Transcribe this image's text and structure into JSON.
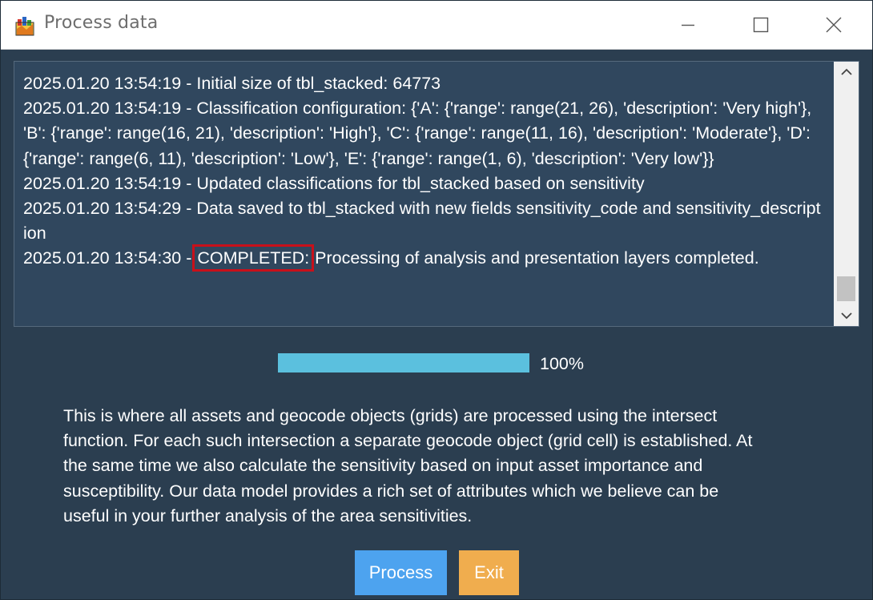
{
  "window": {
    "title": "Process data",
    "app_icon": "app-icon"
  },
  "log": {
    "lines": [
      "2025.01.20 13:54:19 - Initial size of tbl_stacked: 64773",
      "2025.01.20 13:54:19 - Classification configuration: {'A': {'range': range(21, 26), 'description': 'Very high'}, 'B': {'range': range(16, 21), 'description': 'High'}, 'C': {'range': range(11, 16), 'description': 'Moderate'}, 'D': {'range': range(6, 11), 'description': 'Low'}, 'E': {'range': range(1, 6), 'description': 'Very low'}}",
      "2025.01.20 13:54:19 - Updated classifications for tbl_stacked based on sensitivity",
      "2025.01.20 13:54:29 - Data saved to tbl_stacked with new fields sensitivity_code and sensitivity_description"
    ],
    "last_line": {
      "prefix": "2025.01.20 13:54:30 - ",
      "highlighted": "COMPLETED:",
      "suffix": " Processing of analysis and presentation layers completed."
    }
  },
  "progress": {
    "value": 1.0,
    "label": "100%"
  },
  "description": {
    "lines": [
      "This is where all assets and geocode objects (grids) are processed using the intersect",
      "function. For each such intersection a separate geocode object (grid cell) is established. At",
      "the same time we also calculate the sensitivity based on input asset importance and",
      "susceptibility. Our data model provides a rich set of attributes which we believe can be",
      "useful in your further analysis of the area sensitivities."
    ]
  },
  "buttons": {
    "process_label": "Process",
    "exit_label": "Exit"
  },
  "colors": {
    "background": "#2b3e50",
    "log_background": "#30475e",
    "progress_fill": "#5bc0de",
    "process_button": "#4da3ef",
    "exit_button": "#f0ad4e",
    "highlight_box": "#c8101a"
  }
}
